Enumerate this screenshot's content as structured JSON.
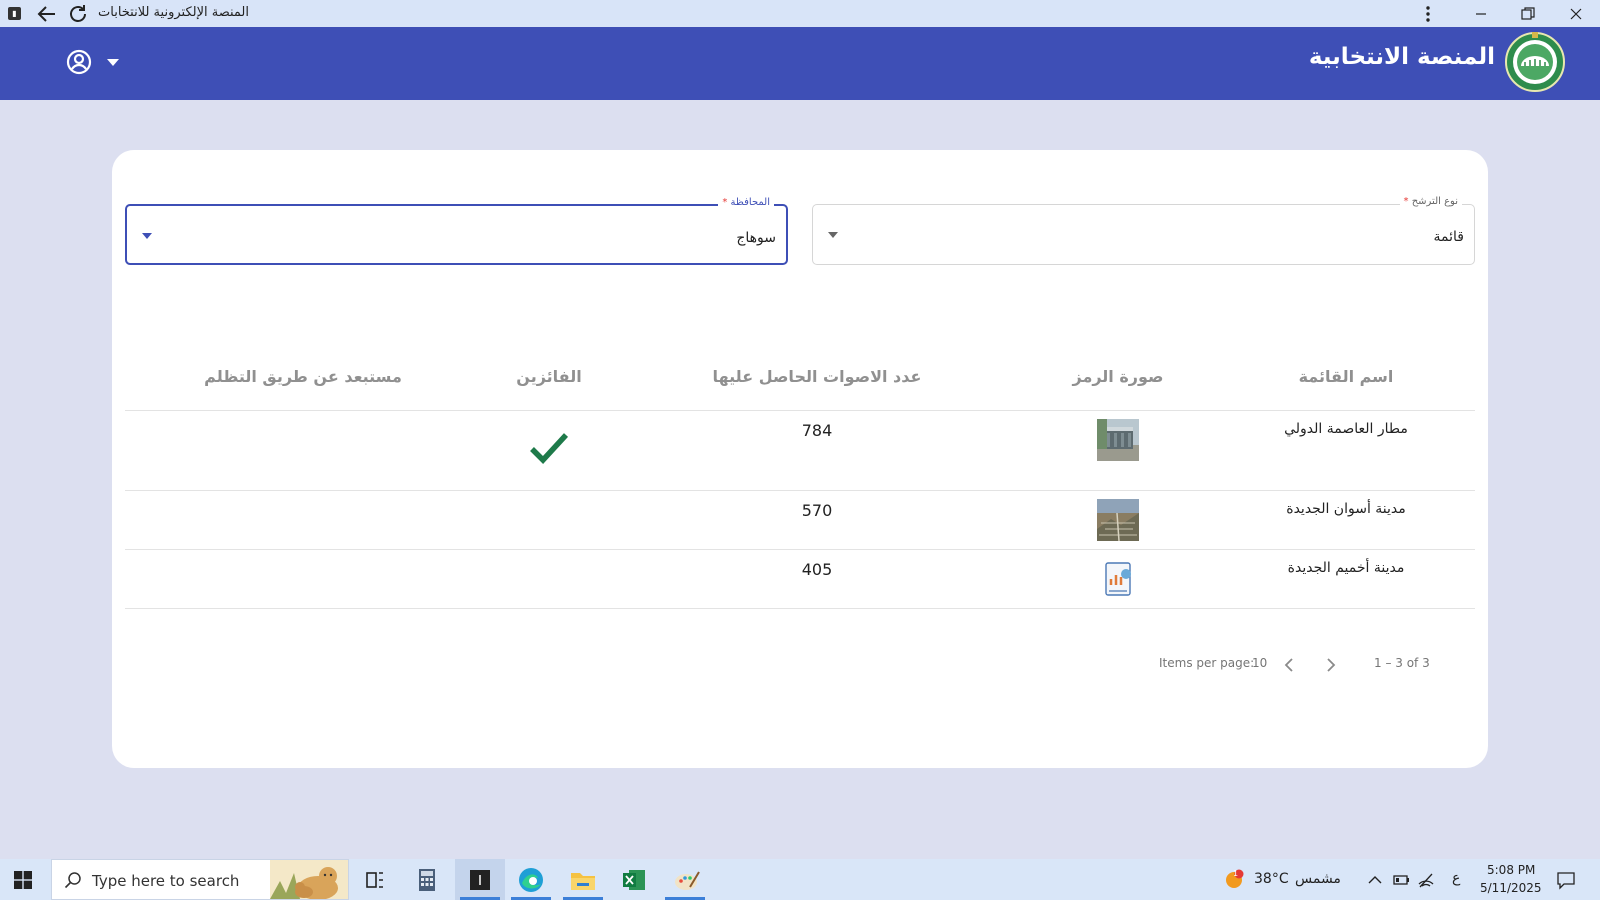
{
  "window": {
    "title": "المنصة الإلكترونية للانتخابات"
  },
  "header": {
    "brand": "المنصة الانتخابية"
  },
  "filters": {
    "candidacy_type": {
      "label": "نوع الترشح",
      "value": "قائمة"
    },
    "governorate": {
      "label": "المحافظة",
      "value": "سوهاج"
    }
  },
  "table": {
    "headers": {
      "list_name": "اسم القائمة",
      "symbol_image": "صورة الرمز",
      "votes": "عدد الاصوات الحاصل عليها",
      "winners": "الفائزين",
      "excluded": "مستبعد عن طريق التظلم"
    },
    "rows": [
      {
        "list_name": "مطار العاصمة الدولي",
        "votes": "784",
        "winner": true
      },
      {
        "list_name": "مدينة أسوان الجديدة",
        "votes": "570",
        "winner": false
      },
      {
        "list_name": "مدينة أخميم الجديدة",
        "votes": "405",
        "winner": false
      }
    ]
  },
  "paginator": {
    "items_per_page_label": "Items per page:",
    "page_size": "10",
    "range": "1 – 3 of 3"
  },
  "taskbar": {
    "search_placeholder": "Type here to search",
    "weather_temp": "38°C",
    "weather_desc": "مشمس",
    "weather_badge": "1",
    "lang": "ع",
    "time": "5:08 PM",
    "date": "5/11/2025"
  },
  "colors": {
    "primary": "#3e4fb6",
    "page_bg": "#dcdff0",
    "check": "#1e7a4a",
    "header_text": "#909090"
  }
}
